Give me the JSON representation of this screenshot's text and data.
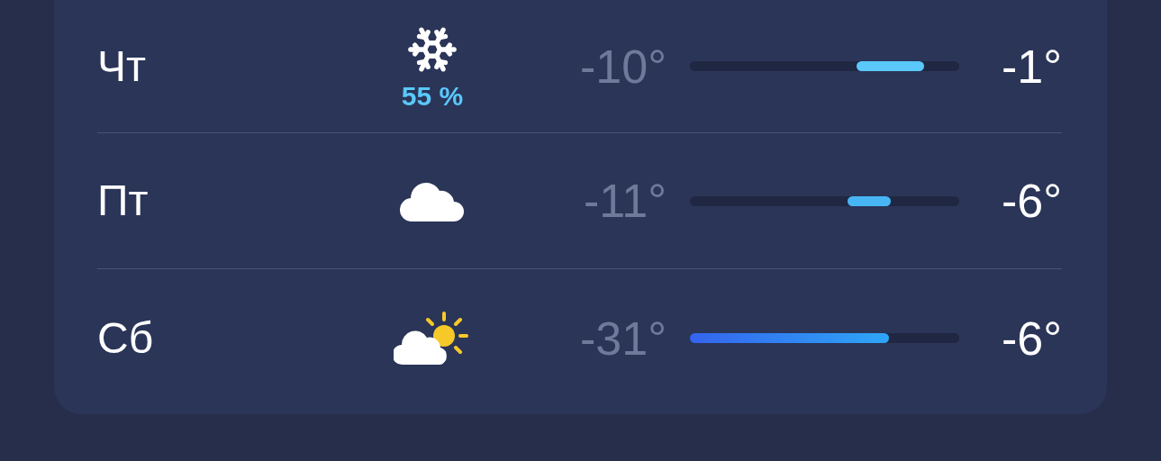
{
  "forecast": [
    {
      "day": "Чт",
      "icon": {
        "kind": "snow"
      },
      "precipitation": "55 %",
      "low": "-10°",
      "high": "-1°",
      "range": {
        "color": "#5ac8fa",
        "gradient": false
      }
    },
    {
      "day": "Пт",
      "icon": {
        "kind": "cloud"
      },
      "low": "-11°",
      "high": "-6°",
      "range": {
        "color": "#48b6f4",
        "gradient": false
      }
    },
    {
      "day": "Сб",
      "icon": {
        "kind": "partly-sunny"
      },
      "low": "-31°",
      "high": "-6°",
      "range": {
        "color": "#2ea6f6",
        "gradient": true
      }
    }
  ]
}
